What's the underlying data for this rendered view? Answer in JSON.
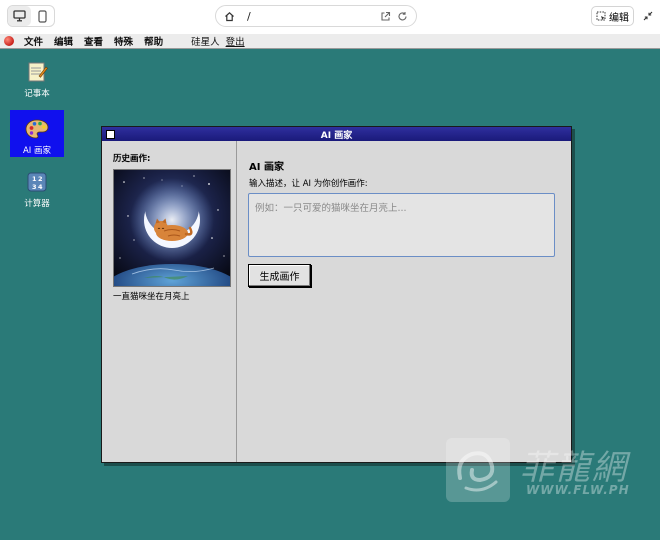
{
  "browser": {
    "address_path": "/",
    "edit_label": "编辑"
  },
  "menubar": {
    "items": [
      "文件",
      "编辑",
      "查看",
      "特殊",
      "帮助"
    ],
    "user": "硅星人",
    "logout": "登出"
  },
  "desktop": {
    "icons": [
      {
        "label": "记事本",
        "icon": "notepad-icon"
      },
      {
        "label": "AI 画家",
        "icon": "palette-icon",
        "selected": true
      },
      {
        "label": "计算器",
        "icon": "calculator-icon"
      }
    ]
  },
  "window": {
    "title": "AI 画家",
    "history_title": "历史画作:",
    "history_items": [
      {
        "caption": "一直猫咪坐在月亮上"
      }
    ],
    "heading": "AI 画家",
    "subheading": "输入描述，让 AI 为你创作画作:",
    "prompt_value": "",
    "prompt_placeholder": "例如：一只可爱的猫咪坐在月亮上...",
    "generate_label": "生成画作"
  },
  "watermark": {
    "text": "菲龍網",
    "url": "WWW.FLW.PH"
  },
  "colors": {
    "desktop_bg": "#2a7a78",
    "titlebar": "#1f1f88",
    "selection": "#1010ee",
    "window_bg": "#d9d9d9"
  }
}
